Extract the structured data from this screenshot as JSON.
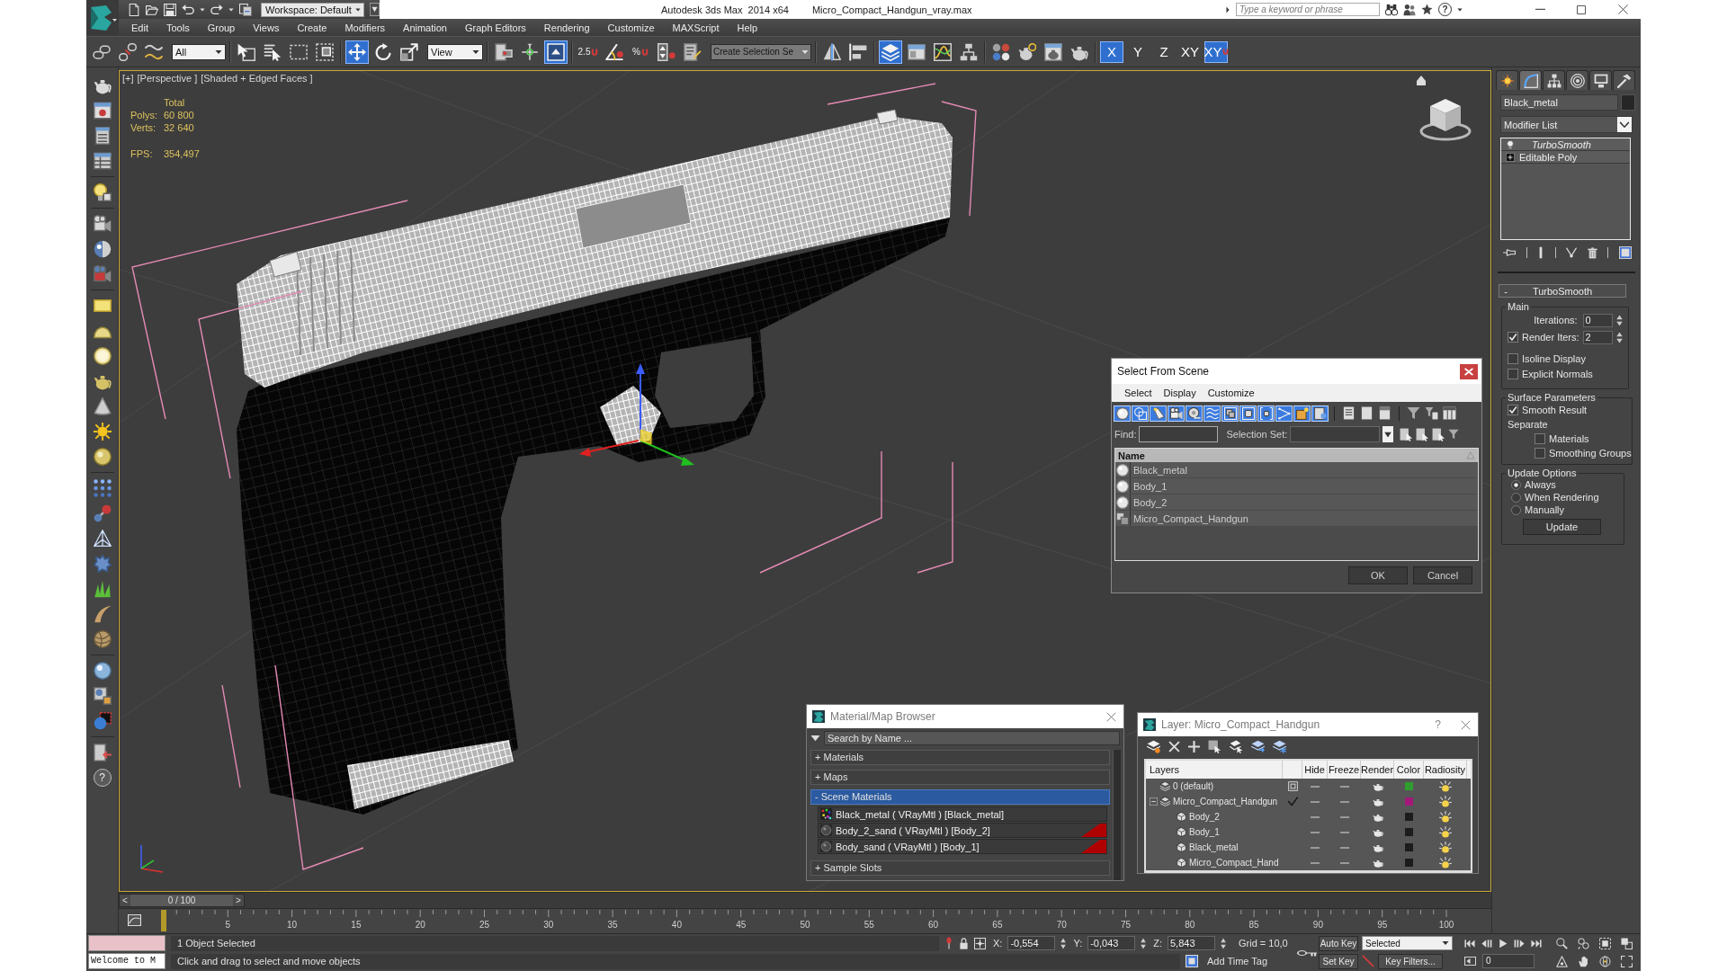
{
  "title_bar": {
    "workspace": "Workspace: Default",
    "title": "Autodesk 3ds Max  2014 x64",
    "file": "Micro_Compact_Handgun_vray.max",
    "search": {
      "placeholder": "Type a keyword or phrase"
    },
    "help": "?"
  },
  "menu_bar": [
    "Edit",
    "Tools",
    "Group",
    "Views",
    "Create",
    "Modifiers",
    "Animation",
    "Graph Editors",
    "Rendering",
    "Customize",
    "MAXScript",
    "Help"
  ],
  "main_toolbar": [
    {
      "kind": "link",
      "on": false
    },
    {
      "kind": "unlink",
      "on": false
    },
    {
      "kind": "bind",
      "on": false
    },
    {
      "kind": "dropdown",
      "value": "All"
    },
    {
      "kind": "select",
      "on": false
    },
    {
      "kind": "select-by-name",
      "on": false
    },
    {
      "kind": "region",
      "on": false
    },
    {
      "kind": "crossing",
      "on": false
    },
    {
      "kind": "move",
      "on": true
    },
    {
      "kind": "rotate",
      "on": false
    },
    {
      "kind": "scale",
      "on": false
    },
    {
      "kind": "dropdown",
      "value": "View"
    },
    {
      "kind": "pivot",
      "on": false
    },
    {
      "kind": "manipulate",
      "on": false
    },
    {
      "kind": "override",
      "on": true
    },
    {
      "kind": "snap",
      "label": "2.5",
      "on": false
    },
    {
      "kind": "angle-snap",
      "on": false
    },
    {
      "kind": "percent-snap",
      "label": "%",
      "on": false
    },
    {
      "kind": "spinner-snap",
      "on": false
    },
    {
      "kind": "named-sets",
      "on": false
    },
    {
      "kind": "dropdown",
      "placeholder": "Create Selection Se"
    },
    {
      "kind": "mirror",
      "on": false
    },
    {
      "kind": "align",
      "on": false
    },
    {
      "kind": "layers",
      "on": true
    },
    {
      "kind": "ribbon",
      "on": false
    },
    {
      "kind": "curve-editor",
      "on": false
    },
    {
      "kind": "schematic",
      "on": false
    },
    {
      "kind": "material-editor",
      "on": false
    },
    {
      "kind": "render-setup",
      "on": false
    },
    {
      "kind": "frame-window",
      "on": false
    },
    {
      "kind": "render",
      "on": false
    },
    {
      "kind": "axis",
      "label": "X",
      "on": true
    },
    {
      "kind": "axis",
      "label": "Y",
      "on": false
    },
    {
      "kind": "axis",
      "label": "Z",
      "on": false
    },
    {
      "kind": "axis",
      "label": "XY",
      "on": false
    },
    {
      "kind": "axis-snap",
      "label": "XY",
      "on": true
    }
  ],
  "left_toolbar": {
    "help": "?"
  },
  "viewport": {
    "labels": [
      "[+]",
      "[Perspective ]",
      "[Shaded + Edged Faces ]"
    ],
    "stats": {
      "heading": "Total",
      "rows": [
        {
          "label": "Polys:",
          "value": "60 800"
        },
        {
          "label": "Verts:",
          "value": "32 640"
        },
        {
          "label": "FPS:",
          "value": "354,497"
        }
      ]
    }
  },
  "select_from_scene": {
    "title": "Select From Scene",
    "menu": [
      "Select",
      "Display",
      "Customize"
    ],
    "filters": [
      {
        "kind": "geometry",
        "on": true
      },
      {
        "kind": "shapes",
        "on": true
      },
      {
        "kind": "lights",
        "on": true
      },
      {
        "kind": "cameras",
        "on": true
      },
      {
        "kind": "helpers",
        "on": true
      },
      {
        "kind": "space-warps",
        "on": true
      },
      {
        "kind": "groups",
        "on": true
      },
      {
        "kind": "xrefs",
        "on": true
      },
      {
        "kind": "bones",
        "on": true
      },
      {
        "kind": "containers",
        "on": true
      },
      {
        "kind": "frozen",
        "on": true
      },
      {
        "kind": "hidden",
        "on": true
      }
    ],
    "find_label": "Find:",
    "selection_set_label": "Selection Set:",
    "column": "Name",
    "rows": [
      {
        "name": "Black_metal",
        "kind": "geometry",
        "selected": false
      },
      {
        "name": "Body_1",
        "kind": "geometry",
        "selected": false
      },
      {
        "name": "Body_2",
        "kind": "geometry",
        "selected": false
      },
      {
        "name": "Micro_Compact_Handgun",
        "kind": "group",
        "selected": false
      }
    ],
    "buttons": [
      "OK",
      "Cancel"
    ]
  },
  "material_browser": {
    "title": "Material/Map Browser",
    "search": {
      "placeholder": "Search by Name ..."
    },
    "groups": [
      {
        "label": "+ Materials",
        "selected": false
      },
      {
        "label": "+ Maps",
        "selected": false
      },
      {
        "label": "- Scene Materials",
        "selected": true,
        "items": [
          {
            "name": "Black_metal ( VRayMtl ) [Black_metal]",
            "kind": "checker",
            "flagged": false
          },
          {
            "name": "Body_2_sand ( VRayMtl ) [Body_2]",
            "kind": "sphere",
            "flagged": true
          },
          {
            "name": "Body_sand ( VRayMtl ) [Body_1]",
            "kind": "sphere",
            "flagged": true
          }
        ]
      },
      {
        "label": "+ Sample Slots",
        "selected": false
      }
    ]
  },
  "layer_dialog": {
    "title": "Layer: Micro_Compact_Handgun",
    "help": "?",
    "columns": [
      "Layers",
      "Hide",
      "Freeze",
      "Render",
      "Color",
      "Radiosity"
    ],
    "rows": [
      {
        "kind": "layer",
        "name": "0 (default)",
        "selected": false,
        "current": false,
        "hidden": false,
        "frozen": false,
        "color": "#2f9e2f"
      },
      {
        "kind": "layer",
        "name": "Micro_Compact_Handgun",
        "selected": false,
        "current": true,
        "expanded": true,
        "hidden": false,
        "frozen": false,
        "color": "#a3187a",
        "children": [
          {
            "kind": "object",
            "name": "Body_2",
            "selected": false,
            "hidden": false,
            "frozen": false,
            "color": "#1c1c1c"
          },
          {
            "kind": "object",
            "name": "Body_1",
            "selected": false,
            "hidden": false,
            "frozen": false,
            "color": "#1c1c1c"
          },
          {
            "kind": "object",
            "name": "Black_metal",
            "selected": false,
            "hidden": false,
            "frozen": false,
            "color": "#1c1c1c"
          },
          {
            "kind": "object",
            "name": "Micro_Compact_Hand",
            "selected": false,
            "hidden": false,
            "frozen": false,
            "color": "#1c1c1c"
          }
        ]
      }
    ]
  },
  "command_panel": {
    "tabs": [
      {
        "kind": "create",
        "selected": false
      },
      {
        "kind": "modify",
        "selected": true
      },
      {
        "kind": "hierarchy",
        "selected": false
      },
      {
        "kind": "motion",
        "selected": false
      },
      {
        "kind": "display",
        "selected": false
      },
      {
        "kind": "utilities",
        "selected": false
      }
    ],
    "object_name": "Black_metal",
    "modifier_list": "Modifier List",
    "stack": [
      {
        "name": "TurboSmooth",
        "kind": "modifier",
        "selected": false
      },
      {
        "name": "Editable Poly",
        "kind": "base",
        "selected": false
      }
    ],
    "rollout": {
      "toggle": "-",
      "title": "TurboSmooth",
      "main": {
        "title": "Main",
        "iterations": {
          "label": "Iterations:",
          "value": "0"
        },
        "render_iters": {
          "label": "Render Iters:",
          "checked": true,
          "value": "2"
        },
        "isoline_display": {
          "label": "Isoline Display",
          "checked": false
        },
        "explicit_normals": {
          "label": "Explicit Normals",
          "checked": false
        }
      },
      "surface": {
        "title": "Surface Parameters",
        "smooth_result": {
          "label": "Smooth Result",
          "checked": true
        },
        "separate": "Separate",
        "materials": {
          "label": "Materials",
          "checked": false
        },
        "smoothing_groups": {
          "label": "Smoothing Groups",
          "checked": false
        }
      },
      "update": {
        "title": "Update Options",
        "options": [
          {
            "label": "Always",
            "selected": true
          },
          {
            "label": "When Rendering",
            "selected": false
          },
          {
            "label": "Manually",
            "selected": false
          }
        ],
        "button": "Update"
      }
    }
  },
  "time_slider": {
    "prev": "<",
    "label": "0 / 100",
    "next": ">",
    "level": 0
  },
  "track_bar": {
    "ticks": [
      "5",
      "10",
      "15",
      "20",
      "25",
      "30",
      "35",
      "40",
      "45",
      "50",
      "55",
      "60",
      "65",
      "70",
      "75",
      "80",
      "85",
      "90",
      "95",
      "100"
    ]
  },
  "status_bar": {
    "listener": "Welcome to M",
    "selection": "1 Object Selected",
    "prompt": "Click and drag to select and move objects",
    "coords": [
      {
        "axis": "X:",
        "value": "-0,554"
      },
      {
        "axis": "Y:",
        "value": "-0,043"
      },
      {
        "axis": "Z:",
        "value": "5,843"
      }
    ],
    "grid": "Grid = 10,0",
    "time_tag": "Add Time Tag",
    "auto_key": {
      "label": "Auto Key",
      "on": false
    },
    "set_key": "Set Key",
    "key_mode": "Selected",
    "key_filters": "Key Filters...",
    "frame": "0"
  }
}
